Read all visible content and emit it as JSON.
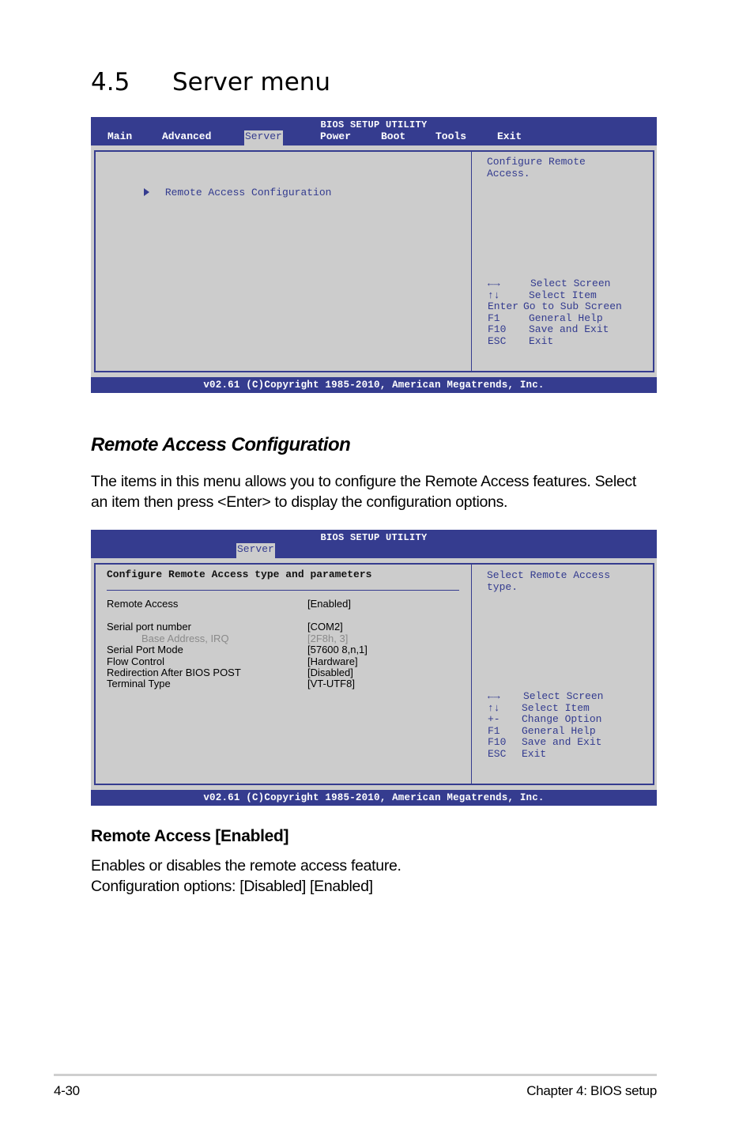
{
  "section": {
    "number": "4.5",
    "title": "Server menu"
  },
  "bios_main": {
    "utility_title": "BIOS SETUP UTILITY",
    "tabs": [
      {
        "label": "Main",
        "active": false
      },
      {
        "label": "Advanced",
        "active": false
      },
      {
        "label": "Server",
        "active": true
      },
      {
        "label": "Power",
        "active": false
      },
      {
        "label": "Boot",
        "active": false
      },
      {
        "label": "Tools",
        "active": false
      },
      {
        "label": "Exit",
        "active": false
      }
    ],
    "submenu_item": {
      "icon": "triangle-right-icon",
      "label": "Remote Access Configuration"
    },
    "help_text": "Configure Remote\nAccess.",
    "keys": [
      {
        "key": "←→",
        "action": "Select Screen"
      },
      {
        "key": "↑↓",
        "action": "Select Item"
      },
      {
        "key": "Enter",
        "action": "Go to Sub Screen"
      },
      {
        "key": "F1",
        "action": "General Help"
      },
      {
        "key": "F10",
        "action": "Save and Exit"
      },
      {
        "key": "ESC",
        "action": "Exit"
      }
    ],
    "footer": "v02.61 (C)Copyright 1985-2010, American Megatrends, Inc."
  },
  "remote_access_section": {
    "heading": "Remote Access Configuration",
    "paragraph_line1": "The items in this menu allows you to configure the Remote Access features. Select",
    "paragraph_line2": "an item then press <Enter> to display the configuration options."
  },
  "bios_sub": {
    "utility_title": "BIOS SETUP UTILITY",
    "active_tab": "Server",
    "panel_title": "Configure Remote Access type and parameters",
    "settings": [
      {
        "label": "Remote Access",
        "value": "[Enabled]",
        "dim": false
      },
      {
        "label": "Serial port number",
        "value": "[COM2]",
        "dim": false
      },
      {
        "label": "Base Address, IRQ",
        "value": "[2F8h, 3]",
        "dim": true
      },
      {
        "label": "Serial Port Mode",
        "value": "[57600 8,n,1]",
        "dim": false
      },
      {
        "label": "Flow Control",
        "value": "[Hardware]",
        "dim": false
      },
      {
        "label": "Redirection After BIOS POST",
        "value": "[Disabled]",
        "dim": false
      },
      {
        "label": "Terminal Type",
        "value": "[VT-UTF8]",
        "dim": false
      }
    ],
    "help_text": "Select Remote Access\ntype.",
    "keys": [
      {
        "key": "←→",
        "action": "Select Screen"
      },
      {
        "key": "↑↓",
        "action": "Select Item"
      },
      {
        "key": "+-",
        "action": "Change Option"
      },
      {
        "key": "F1",
        "action": "General Help"
      },
      {
        "key": "F10",
        "action": "Save and Exit"
      },
      {
        "key": "ESC",
        "action": "Exit"
      }
    ],
    "footer": "v02.61 (C)Copyright 1985-2010, American Megatrends, Inc."
  },
  "remote_access_item": {
    "heading": "Remote Access [Enabled]",
    "line1": "Enables or disables the remote access feature.",
    "line2": "Configuration options: [Disabled] [Enabled]"
  },
  "page_footer": {
    "page_number": "4-30",
    "chapter": "Chapter 4: BIOS setup"
  },
  "colors": {
    "bios_blue": "#353c8f",
    "bios_gray": "#cccccc",
    "dim_text": "#8a8a8a"
  }
}
